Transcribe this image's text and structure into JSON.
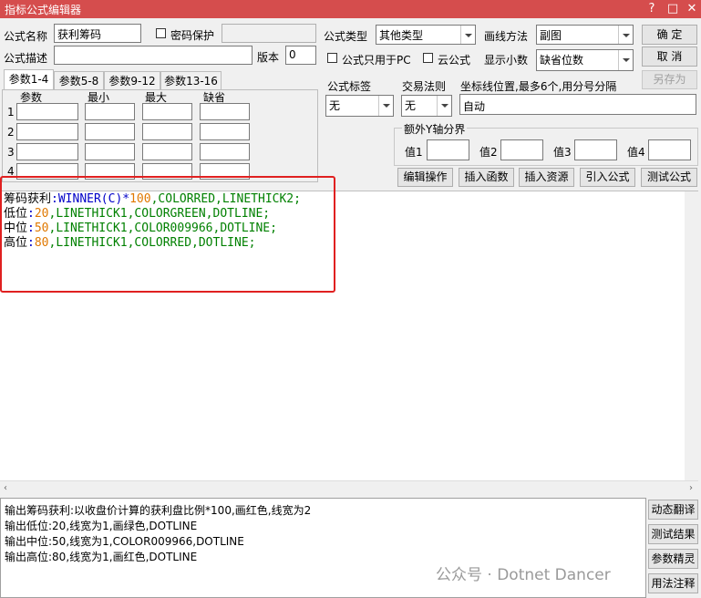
{
  "window": {
    "title": "指标公式编辑器",
    "help_glyph": "?",
    "maximize_glyph": "□",
    "close_glyph": "✕"
  },
  "form": {
    "formula_name_label": "公式名称",
    "formula_name_value": "获利筹码",
    "password_label": "密码保护",
    "formula_desc_label": "公式描述",
    "formula_desc_value": "",
    "version_label": "版本",
    "version_value": "0",
    "formula_type_label": "公式类型",
    "formula_type_value": "其他类型",
    "draw_method_label": "画线方法",
    "draw_method_value": "副图",
    "pc_only_label": "公式只用于PC",
    "cloud_label": "云公式",
    "decimals_label": "显示小数",
    "decimals_value": "缺省位数",
    "formula_tag_label": "公式标签",
    "formula_tag_value": "无",
    "trade_rule_label": "交易法则",
    "trade_rule_value": "无",
    "coord_label": "坐标线位置,最多6个,用分号分隔",
    "coord_value": "自动",
    "y_axis_group_label": "额外Y轴分界",
    "y_values": [
      "值1",
      "值2",
      "值3",
      "值4"
    ]
  },
  "buttons": {
    "ok": "确  定",
    "cancel": "取  消",
    "save_as": "另存为",
    "edit_ops": "编辑操作",
    "insert_func": "插入函数",
    "insert_resource": "插入资源",
    "import_formula": "引入公式",
    "test_formula": "测试公式"
  },
  "tabs": [
    "参数1-4",
    "参数5-8",
    "参数9-12",
    "参数13-16"
  ],
  "params": {
    "headers": [
      "参数",
      "最小",
      "最大",
      "缺省"
    ],
    "rows": [
      "1",
      "2",
      "3",
      "4"
    ]
  },
  "code_lines": [
    [
      {
        "t": "筹码获利",
        "c": "black"
      },
      {
        "t": ":WINNER(C)*",
        "c": "blue"
      },
      {
        "t": "100",
        "c": "orange"
      },
      {
        "t": ",COLORRED,LINETHICK2;",
        "c": "green"
      }
    ],
    [
      {
        "t": "低位",
        "c": "black"
      },
      {
        "t": ":",
        "c": "blue"
      },
      {
        "t": "20",
        "c": "orange"
      },
      {
        "t": ",LINETHICK1,COLORGREEN,DOTLINE;",
        "c": "green"
      }
    ],
    [
      {
        "t": "中位",
        "c": "black"
      },
      {
        "t": ":",
        "c": "blue"
      },
      {
        "t": "50",
        "c": "orange"
      },
      {
        "t": ",LINETHICK1,COLOR009966,DOTLINE;",
        "c": "green"
      }
    ],
    [
      {
        "t": "高位",
        "c": "black"
      },
      {
        "t": ":",
        "c": "blue"
      },
      {
        "t": "80",
        "c": "orange"
      },
      {
        "t": ",LINETHICK1,COLORRED,DOTLINE;",
        "c": "green"
      }
    ]
  ],
  "colors": {
    "black": "#000000",
    "blue": "#0000c8",
    "orange": "#e07800",
    "green": "#008000",
    "title_bar": "#d54d4d",
    "highlight_box": "#e02020"
  },
  "output_lines": [
    "输出筹码获利:以收盘价计算的获利盘比例*100,画红色,线宽为2",
    "输出低位:20,线宽为1,画绿色,DOTLINE",
    "输出中位:50,线宽为1,COLOR009966,DOTLINE",
    "输出高位:80,线宽为1,画红色,DOTLINE"
  ],
  "side_buttons": [
    "动态翻译",
    "测试结果",
    "参数精灵",
    "用法注释"
  ],
  "watermark": "公众号 · Dotnet Dancer"
}
